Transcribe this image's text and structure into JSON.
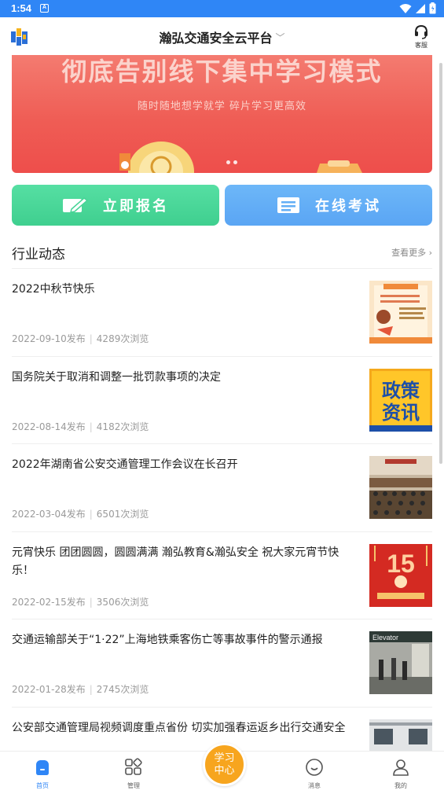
{
  "status": {
    "time": "1:54",
    "notif": "A"
  },
  "header": {
    "title": "瀚弘交通安全云平台",
    "service_label": "客服"
  },
  "banner": {
    "headline": "彻底告别线下集中学习模式",
    "subline": "随时随地想学就学  碎片学习更高效"
  },
  "actions": {
    "enroll": "立即报名",
    "exam": "在线考试"
  },
  "section": {
    "title": "行业动态",
    "more": "查看更多"
  },
  "news": [
    {
      "title": "2022中秋节快乐",
      "date": "2022-09-10发布",
      "views": "4289次浏览",
      "thumb": "festival-poster"
    },
    {
      "title": "国务院关于取消和调整一批罚款事项的决定",
      "date": "2022-08-14发布",
      "views": "4182次浏览",
      "thumb": "policy-news",
      "thumb_text": [
        "政策",
        "资讯"
      ]
    },
    {
      "title": "2022年湖南省公安交通管理工作会议在长召开",
      "date": "2022-03-04发布",
      "views": "6501次浏览",
      "thumb": "meeting-photo"
    },
    {
      "title": "元宵快乐 团团圆圆，圆圆满满 瀚弘教育&瀚弘安全 祝大家元宵节快乐！",
      "date": "2022-02-15发布",
      "views": "3506次浏览",
      "thumb": "lantern-poster",
      "thumb_text": [
        "15"
      ]
    },
    {
      "title": "交通运输部关于“1·22”上海地铁乘客伤亡等事故事件的警示通报",
      "date": "2022-01-28发布",
      "views": "2745次浏览",
      "thumb": "metro-photo",
      "thumb_text": [
        "Elevator"
      ]
    },
    {
      "title": "公安部交通管理局视频调度重点省份 切实加强春运返乡出行交通安全",
      "date": "",
      "views": "",
      "thumb": "office-photo"
    }
  ],
  "tabs": [
    {
      "label": "首页",
      "icon": "home-icon",
      "active": true
    },
    {
      "label": "管理",
      "icon": "grid-icon",
      "active": false
    },
    {
      "label": "学习中心",
      "icon": "",
      "active": false
    },
    {
      "label": "消息",
      "icon": "message-icon",
      "active": false
    },
    {
      "label": "我的",
      "icon": "user-icon",
      "active": false
    }
  ],
  "colors": {
    "primary": "#2f86f6",
    "green": "#46d496",
    "blue": "#62aef6",
    "orange": "#f7a51e",
    "banner": "#ef5d55"
  }
}
